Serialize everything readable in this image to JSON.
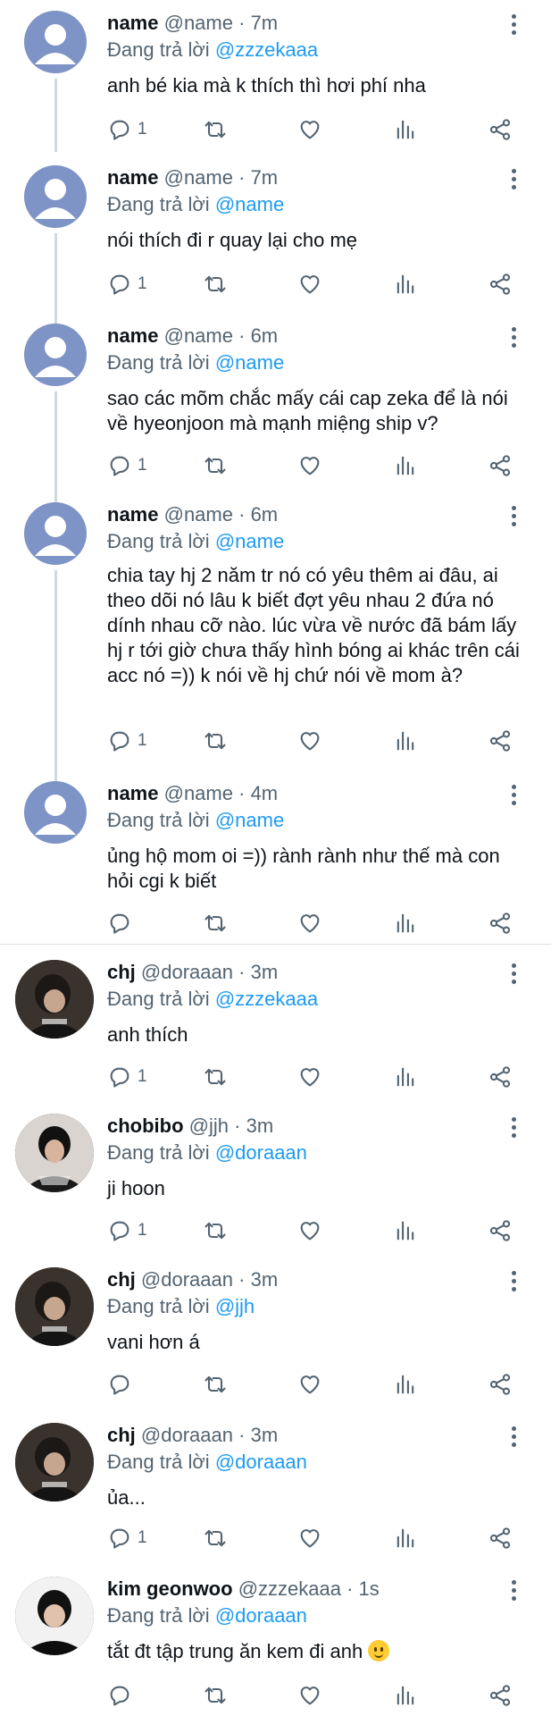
{
  "labels": {
    "replying_to": "Đang trả lời",
    "separator": "·"
  },
  "colors": {
    "accent": "#1d9bf0",
    "secondary_text": "#536471",
    "default_avatar": "#7e93c6"
  },
  "tweets": [
    {
      "name": "name",
      "handle": "@name",
      "time": "7m",
      "reply_to": "@zzzekaaa",
      "text": "anh bé kia mà k thích thì hơi phí nha",
      "replies": "1",
      "avatar": "default-avatar"
    },
    {
      "name": "name",
      "handle": "@name",
      "time": "7m",
      "reply_to": "@name",
      "text": "nói thích đi r quay lại cho mẹ",
      "replies": "1",
      "avatar": "default-avatar"
    },
    {
      "name": "name",
      "handle": "@name",
      "time": "6m",
      "reply_to": "@name",
      "text": "sao các mõm chắc mấy cái cap zeka để là nói về hyeonjoon mà mạnh miệng ship v?",
      "replies": "1",
      "avatar": "default-avatar"
    },
    {
      "name": "name",
      "handle": "@name",
      "time": "6m",
      "reply_to": "@name",
      "text": "chia tay hj 2 năm tr nó có yêu thêm ai đâu, ai theo dõi nó lâu k biết đợt yêu nhau 2 đứa nó dính nhau cỡ nào. lúc vừa về nước đã bám lấy hj r tới giờ chưa thấy hình bóng ai khác trên cái acc nó =)) k nói về hj chứ nói về mom à?",
      "replies": "1",
      "avatar": "default-avatar"
    },
    {
      "name": "name",
      "handle": "@name",
      "time": "4m",
      "reply_to": "@name",
      "text": "ủng hộ mom oi =)) rành rành như thế mà con hỏi cgi k biết",
      "replies": "",
      "avatar": "default-avatar"
    },
    {
      "name": "chj",
      "handle": "@doraaan",
      "time": "3m",
      "reply_to": "@zzzekaaa",
      "text": "anh thích",
      "replies": "1",
      "avatar": "profile-photo"
    },
    {
      "name": "chobibo",
      "handle": "@jjh",
      "time": "3m",
      "reply_to": "@doraaan",
      "text": "ji hoon",
      "replies": "1",
      "avatar": "profile-photo"
    },
    {
      "name": "chj",
      "handle": "@doraaan",
      "time": "3m",
      "reply_to": "@jjh",
      "text": "vani hơn á",
      "replies": "",
      "avatar": "profile-photo"
    },
    {
      "name": "chj",
      "handle": "@doraaan",
      "time": "3m",
      "reply_to": "@doraaan",
      "text": "ủa...",
      "replies": "1",
      "avatar": "profile-photo"
    },
    {
      "name": "kim geonwoo",
      "handle": "@zzzekaaa",
      "time": "1s",
      "reply_to": "@doraaan",
      "text": "tắt đt tập trung ăn kem đi anh",
      "replies": "",
      "avatar": "profile-photo",
      "emoji": "slightly-smiling-face"
    }
  ]
}
